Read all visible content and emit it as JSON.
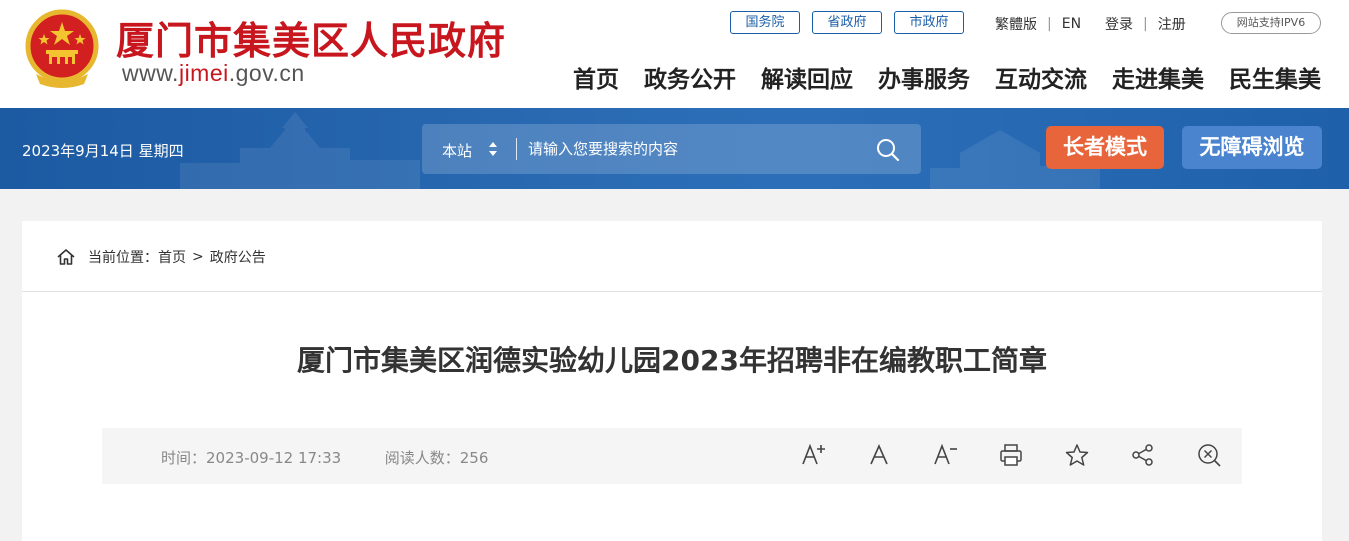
{
  "header": {
    "title": "厦门市集美区人民政府",
    "url_prefix": "www.",
    "url_highlight": "jimei",
    "url_suffix": ".gov.cn",
    "gov_links": [
      "国务院",
      "省政府",
      "市政府"
    ],
    "traditional": "繁體版",
    "english": "EN",
    "login": "登录",
    "register": "注册",
    "ipv6": "网站支持IPV6",
    "nav": [
      "首页",
      "政务公开",
      "解读回应",
      "办事服务",
      "互动交流",
      "走进集美",
      "民生集美"
    ]
  },
  "band": {
    "date": "2023年9月14日 星期四",
    "search_scope": "本站",
    "search_placeholder": "请输入您要搜索的内容",
    "elder_mode": "长者模式",
    "accessibility": "无障碍浏览"
  },
  "breadcrumb": {
    "label": "当前位置：",
    "home": "首页",
    "separator": ">",
    "current": "政府公告"
  },
  "article": {
    "title": "厦门市集美区润德实验幼儿园2023年招聘非在编教职工简章",
    "time_label": "时间：",
    "time_value": "2023-09-12 17:33",
    "views_label": "阅读人数：",
    "views_value": "256"
  },
  "tools": [
    "font-increase-icon",
    "font-default-icon",
    "font-decrease-icon",
    "print-icon",
    "star-icon",
    "share-icon",
    "zoom-icon"
  ],
  "colors": {
    "brand_red": "#c8161e",
    "band_blue": "#2a6bb4",
    "elder_orange": "#e8643a",
    "access_blue": "#4a84cf",
    "nav_text": "#222222"
  }
}
